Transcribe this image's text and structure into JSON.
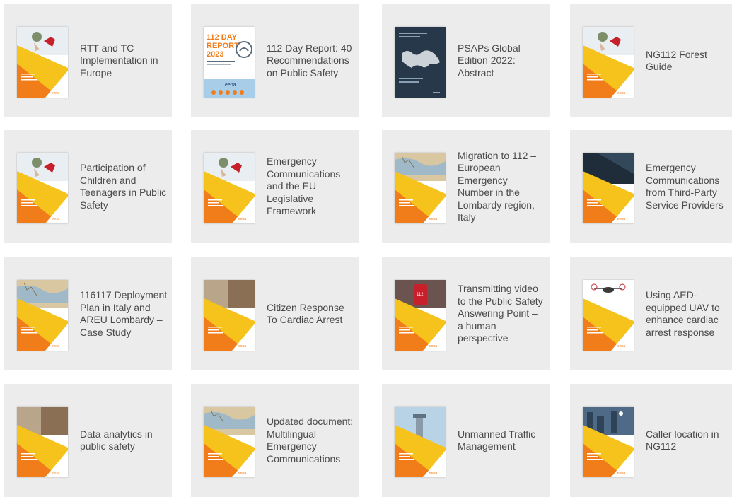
{
  "cards": [
    {
      "title": "RTT and TC Implementation in Europe",
      "cover": "yellow-hands",
      "icon": "report-cover-icon"
    },
    {
      "title": "112 Day Report: 40 Recommendations on Public Safety",
      "cover": "day-report",
      "cover_heading": "112 DAY REPORT 2023",
      "cover_brand": "eena",
      "icon": "report-cover-icon"
    },
    {
      "title": "PSAPs Global Edition 2022: Abstract",
      "cover": "dark-map",
      "icon": "report-cover-icon"
    },
    {
      "title": "NG112 Forest Guide",
      "cover": "yellow-hands",
      "icon": "report-cover-icon"
    },
    {
      "title": "Participation of Children and Teenagers in Public Safety",
      "cover": "yellow-hands",
      "icon": "report-cover-icon"
    },
    {
      "title": "Emergency Communications and the EU Legislative Framework",
      "cover": "yellow-hands",
      "icon": "report-cover-icon"
    },
    {
      "title": "Migration to 112 – European Emergency Number in the Lombardy region, Italy",
      "cover": "map-photo",
      "icon": "report-cover-icon"
    },
    {
      "title": "Emergency Communications from Third-Party Service Providers",
      "cover": "dark-top",
      "icon": "report-cover-icon"
    },
    {
      "title": "116117 Deployment Plan in Italy and AREU Lombardy – Case Study",
      "cover": "map-photo",
      "icon": "report-cover-icon"
    },
    {
      "title": "Citizen Response To Cardiac Arrest",
      "cover": "photo-top",
      "icon": "report-cover-icon"
    },
    {
      "title": "Transmitting video to the Public Safety Answering Point – a human perspective",
      "cover": "red-phone",
      "icon": "report-cover-icon"
    },
    {
      "title": "Using AED-equipped UAV to enhance cardiac arrest response",
      "cover": "drone",
      "icon": "report-cover-icon"
    },
    {
      "title": "Data analytics in public safety",
      "cover": "photo-top",
      "icon": "report-cover-icon"
    },
    {
      "title": "Updated document: Multilingual Emergency Communications",
      "cover": "map-photo",
      "icon": "report-cover-icon"
    },
    {
      "title": "Unmanned Traffic Management",
      "cover": "sky",
      "icon": "report-cover-icon"
    },
    {
      "title": "Caller location in NG112",
      "cover": "city",
      "icon": "report-cover-icon"
    }
  ],
  "colors": {
    "card_bg": "#ececec",
    "yellow": "#f6c21c",
    "orange": "#f07d1a",
    "text": "#4a4a4a"
  }
}
